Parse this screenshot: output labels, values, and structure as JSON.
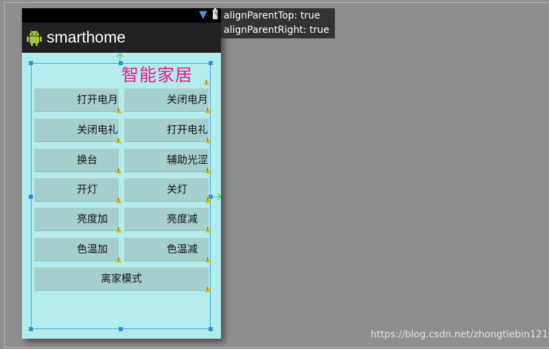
{
  "app": {
    "title": "smarthome"
  },
  "main": {
    "heading": "智能家居",
    "buttons": [
      {
        "left": "打开电月",
        "right": "关闭电月"
      },
      {
        "left": "关闭电礼",
        "right": "打开电礼"
      },
      {
        "left": "换台",
        "right": "辅助光涩"
      },
      {
        "left": "开灯",
        "right": "关灯"
      },
      {
        "left": "亮度加",
        "right": "亮度减"
      },
      {
        "left": "色温加",
        "right": "色温减"
      }
    ],
    "wide_button": "离家模式"
  },
  "tooltip": {
    "line1": "alignParentTop: true",
    "line2": "alignParentRight: true"
  },
  "watermark": "https://blog.csdn.net/zhongtiebin121",
  "colors": {
    "canvas": "#8e8e8e",
    "screen_bg": "#b3ecec",
    "button_bg": "#a4cfcd",
    "heading": "#e8198a",
    "selection": "#3aa3e3",
    "arrow": "#2ecc40"
  },
  "icons": {
    "status": [
      "wifi-icon",
      "battery-icon"
    ],
    "app": "android-icon",
    "lint": "warning-icon"
  }
}
